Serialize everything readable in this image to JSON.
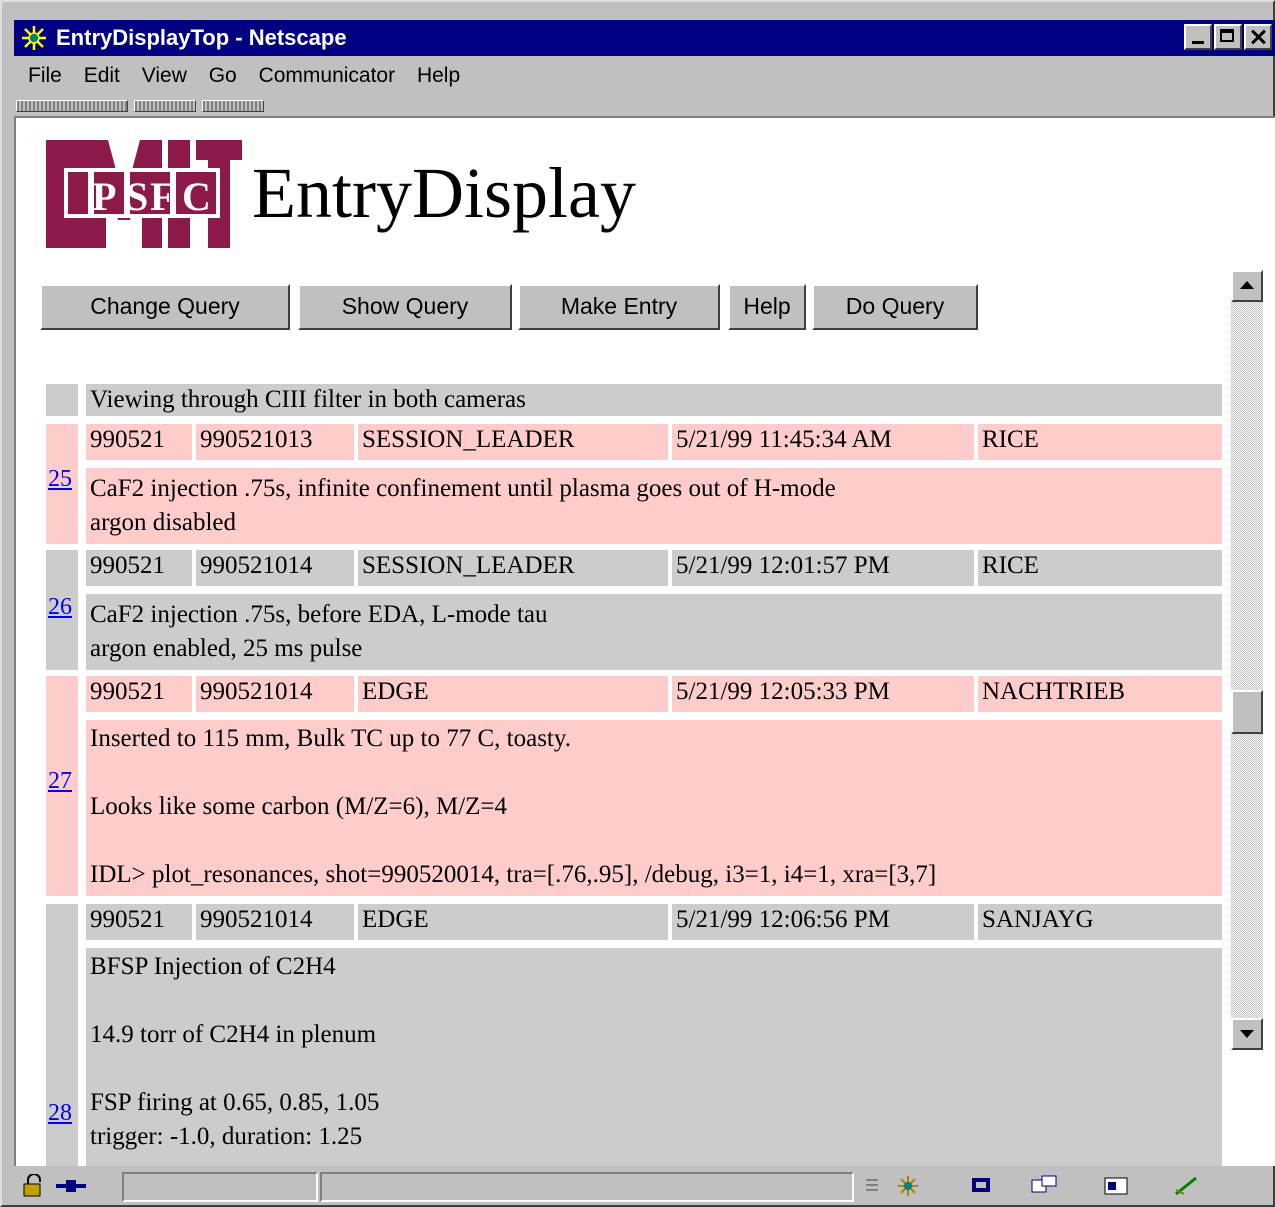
{
  "window": {
    "title": "EntryDisplayTop - Netscape"
  },
  "menu": [
    "File",
    "Edit",
    "View",
    "Go",
    "Communicator",
    "Help"
  ],
  "page": {
    "logo_text": "MIT PSFC",
    "title": "EntryDisplay"
  },
  "buttons": {
    "change_query": "Change Query",
    "show_query": "Show Query",
    "make_entry": "Make Entry",
    "help": "Help",
    "do_query": "Do Query"
  },
  "top_partial": {
    "text": "Viewing through CIII filter in both cameras"
  },
  "entries": [
    {
      "number": "25",
      "run": "990521",
      "shot": "990521013",
      "topic": "SESSION_LEADER",
      "time": "5/21/99 11:45:34 AM",
      "user": "RICE",
      "text": [
        "CaF2 injection .75s, infinite confinement until plasma goes out of H-mode",
        "argon disabled"
      ]
    },
    {
      "number": "26",
      "run": "990521",
      "shot": "990521014",
      "topic": "SESSION_LEADER",
      "time": "5/21/99 12:01:57 PM",
      "user": "RICE",
      "text": [
        "CaF2 injection .75s, before EDA, L-mode tau",
        "argon enabled, 25 ms pulse"
      ]
    },
    {
      "number": "27",
      "run": "990521",
      "shot": "990521014",
      "topic": "EDGE",
      "time": "5/21/99 12:05:33 PM",
      "user": "NACHTRIEB",
      "text": [
        "Inserted to 115 mm, Bulk TC up to 77 C, toasty.",
        "",
        "Looks like some carbon (M/Z=6), M/Z=4",
        "",
        "IDL> plot_resonances, shot=990520014, tra=[.76,.95], /debug, i3=1, i4=1, xra=[3,7]"
      ]
    },
    {
      "number": "28",
      "run": "990521",
      "shot": "990521014",
      "topic": "EDGE",
      "time": "5/21/99 12:06:56 PM",
      "user": "SANJAYG",
      "text": [
        "BFSP Injection of C2H4",
        "",
        "14.9 torr of C2H4 in plenum",
        "",
        "FSP firing at 0.65, 0.85, 1.05",
        "trigger: -1.0, duration: 1.25"
      ]
    }
  ],
  "icons": [
    "netscape-logo-icon",
    "minimize-icon",
    "maximize-icon",
    "close-icon",
    "security-lock-icon",
    "connection-plug-icon",
    "netscape-wheel-icon",
    "mail-icon",
    "discussions-icon",
    "address-book-icon",
    "composer-icon"
  ],
  "colors": {
    "titlebar": "#000080",
    "pink_row": "#ffcccc",
    "gray_row": "#cccccc",
    "logo_maroon": "#8b1a4a",
    "link": "#0000ee"
  }
}
